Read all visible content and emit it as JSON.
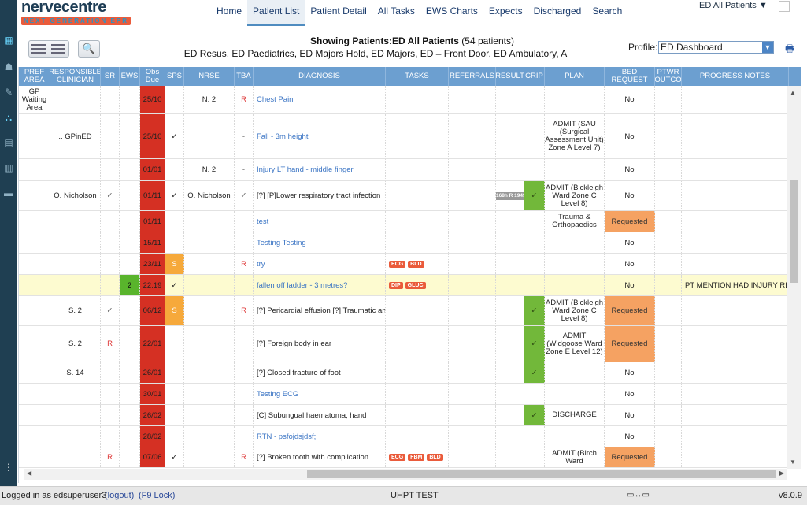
{
  "app": {
    "logo_name": "nervecentre",
    "logo_tag": "NEXT GENERATION EPR"
  },
  "sidebar": {
    "icons": [
      "dashboard-icon",
      "people-icon",
      "pen-icon",
      "workflow-icon",
      "tablet-icon",
      "clipboard-icon",
      "bed-icon",
      "more-icon"
    ]
  },
  "nav": {
    "items": [
      "Home",
      "Patient List",
      "Patient Detail",
      "All Tasks",
      "EWS Charts",
      "Expects",
      "Discharged",
      "Search"
    ],
    "active": "Patient List",
    "ed_selector": "ED All Patients ▼"
  },
  "subbar": {
    "showing_bold": "Showing Patients:ED All Patients",
    "showing_count": "(54 patients)",
    "areas": "ED Resus, ED Paediatrics, ED Majors Hold, ED Majors, ED – Front Door, ED Ambulatory, A",
    "profile_label": "Profile:",
    "profile_value": "ED Dashboard"
  },
  "columns": [
    {
      "key": "pref",
      "label": "PREF AREA"
    },
    {
      "key": "clin",
      "label": "RESPONSIBLE CLINICIAN"
    },
    {
      "key": "sr",
      "label": "SR"
    },
    {
      "key": "ews",
      "label": "EWS"
    },
    {
      "key": "obs",
      "label": "Obs Due"
    },
    {
      "key": "sps",
      "label": "SPS"
    },
    {
      "key": "nrse",
      "label": "NRSE"
    },
    {
      "key": "tba",
      "label": "TBA"
    },
    {
      "key": "diag",
      "label": "DIAGNOSIS"
    },
    {
      "key": "tasks",
      "label": "TASKS"
    },
    {
      "key": "ref",
      "label": "REFERRALS"
    },
    {
      "key": "res",
      "label": "RESULT"
    },
    {
      "key": "crip",
      "label": "CRIP"
    },
    {
      "key": "plan",
      "label": "PLAN"
    },
    {
      "key": "bed",
      "label": "BED REQUEST"
    },
    {
      "key": "ptwr",
      "label": "PTWR OUTCO"
    },
    {
      "key": "notes",
      "label": "PROGRESS NOTES"
    }
  ],
  "rows": [
    {
      "pref": "GP Waiting Area",
      "clin": "",
      "sr": "",
      "ews": "",
      "obs": "25/10",
      "sps": "",
      "nrse": "N. 2",
      "tba": "R",
      "diag": "Chest Pain",
      "tasks": [],
      "res": "",
      "crip": "",
      "plan": "",
      "bed": "No",
      "notes": ""
    },
    {
      "pref": "",
      "clin": ".. GPinED",
      "sr": "",
      "ews": "",
      "obs": "25/10",
      "sps": "✓",
      "nrse": "",
      "tba": "-",
      "diag": "Fall - 3m height",
      "tasks": [],
      "res": "",
      "crip": "",
      "plan": "ADMIT (SAU (Surgical Assessment Unit) Zone A Level 7)",
      "bed": "No",
      "notes": ""
    },
    {
      "pref": "",
      "clin": "",
      "sr": "",
      "ews": "",
      "obs": "01/01",
      "sps": "",
      "nrse": "N. 2",
      "tba": "-",
      "diag": "Injury LT hand - middle finger",
      "tasks": [],
      "res": "",
      "crip": "",
      "plan": "",
      "bed": "No",
      "notes": ""
    },
    {
      "pref": "",
      "clin": "O. Nicholson",
      "sr": "✓",
      "ews": "",
      "obs": "01/11",
      "sps": "✓",
      "nrse": "O. Nicholson",
      "tba": "✓",
      "diag": "[?] [P]Lower respiratory tract infection",
      "tasks": [],
      "res": "R 168h R 1949h",
      "crip": "✓",
      "plan": "ADMIT (Bickleigh Ward Zone C Level 8)",
      "bed": "No",
      "notes": ""
    },
    {
      "pref": "",
      "clin": "",
      "sr": "",
      "ews": "",
      "obs": "01/11",
      "sps": "",
      "nrse": "",
      "tba": "",
      "diag": "test",
      "tasks": [],
      "res": "",
      "crip": "",
      "plan": "Trauma & Orthopaedics",
      "bed": "Requested",
      "notes": ""
    },
    {
      "pref": "",
      "clin": "",
      "sr": "",
      "ews": "",
      "obs": "15/11",
      "sps": "",
      "nrse": "",
      "tba": "",
      "diag": "Testing Testing",
      "tasks": [],
      "res": "",
      "crip": "",
      "plan": "",
      "bed": "No",
      "notes": ""
    },
    {
      "pref": "",
      "clin": "",
      "sr": "",
      "ews": "",
      "obs": "23/11",
      "sps": "S",
      "nrse": "",
      "tba": "R",
      "diag": "try",
      "tasks": [
        "ECG",
        "BLD"
      ],
      "res": "",
      "crip": "",
      "plan": "",
      "bed": "No",
      "notes": ""
    },
    {
      "pref": "",
      "clin": "",
      "sr": "",
      "ews": "2",
      "obs": "22:19",
      "sps": "✓",
      "nrse": "",
      "tba": "",
      "diag": "fallen off ladder - 3 metres?",
      "tasks": [
        "DIP",
        "GLUC"
      ],
      "res": "",
      "crip": "",
      "plan": "",
      "bed": "No",
      "notes": "PT MENTION HAD INJURY REF"
    },
    {
      "pref": "",
      "clin": "S. 2",
      "sr": "✓",
      "ews": "",
      "obs": "06/12",
      "sps": "S",
      "nrse": "",
      "tba": "R",
      "diag": "[?] Pericardial effusion [?] Traumatic amp",
      "tasks": [],
      "res": "",
      "crip": "✓",
      "plan": "ADMIT (Bickleigh Ward Zone C Level 8)",
      "bed": "Requested",
      "notes": ""
    },
    {
      "pref": "",
      "clin": "S. 2",
      "sr": "R",
      "ews": "",
      "obs": "22/01",
      "sps": "",
      "nrse": "",
      "tba": "",
      "diag": "[?] Foreign body in ear",
      "tasks": [],
      "res": "",
      "crip": "✓",
      "plan": "ADMIT (Widgoose Ward Zone E Level 12)",
      "bed": "Requested",
      "notes": ""
    },
    {
      "pref": "",
      "clin": "S. 14",
      "sr": "",
      "ews": "",
      "obs": "26/01",
      "sps": "",
      "nrse": "",
      "tba": "",
      "diag": "[?] Closed fracture of foot",
      "tasks": [],
      "res": "",
      "crip": "✓",
      "plan": "",
      "bed": "No",
      "notes": ""
    },
    {
      "pref": "",
      "clin": "",
      "sr": "",
      "ews": "",
      "obs": "30/01",
      "sps": "",
      "nrse": "",
      "tba": "",
      "diag": "Testing ECG",
      "tasks": [],
      "res": "",
      "crip": "",
      "plan": "",
      "bed": "No",
      "notes": ""
    },
    {
      "pref": "",
      "clin": "",
      "sr": "",
      "ews": "",
      "obs": "26/02",
      "sps": "",
      "nrse": "",
      "tba": "",
      "diag": "[C] Subungual haematoma, hand",
      "tasks": [],
      "res": "",
      "crip": "✓",
      "plan": "DISCHARGE",
      "bed": "No",
      "notes": ""
    },
    {
      "pref": "",
      "clin": "",
      "sr": "",
      "ews": "",
      "obs": "28/02",
      "sps": "",
      "nrse": "",
      "tba": "",
      "diag": "RTN - psfojdsjdsf;",
      "tasks": [],
      "res": "",
      "crip": "",
      "plan": "",
      "bed": "No",
      "notes": ""
    },
    {
      "pref": "",
      "clin": "",
      "sr": "R",
      "ews": "",
      "obs": "07/06",
      "sps": "✓",
      "nrse": "",
      "tba": "R",
      "diag": "[?] Broken tooth with complication",
      "tasks": [
        "ECG",
        "FBM",
        "BLD"
      ],
      "res": "",
      "crip": "",
      "plan": "ADMIT (Birch Ward",
      "bed": "Requested",
      "notes": ""
    }
  ],
  "footer": {
    "logged_in": "Logged in as edsuperuser3",
    "logout": "(logout)",
    "lock": "(F9 Lock)",
    "site": "UHPT TEST",
    "version": "v8.0.9"
  },
  "colors": {
    "header_blue": "#6c9fd0",
    "obs_red": "#d53023",
    "crip_green": "#72b83a",
    "bed_orange": "#f5a262",
    "sps_orange": "#f6a93b",
    "highlight_yellow": "#fdfbd0"
  }
}
